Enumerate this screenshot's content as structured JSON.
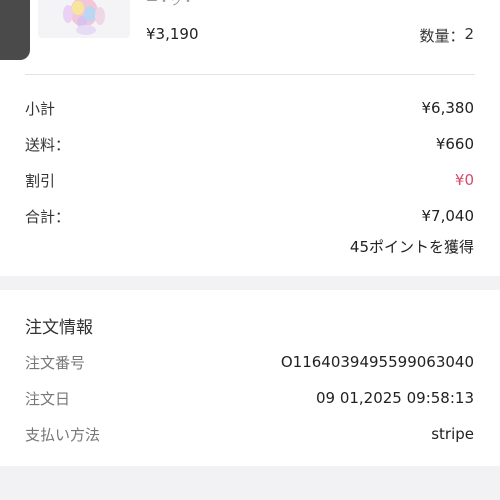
{
  "item": {
    "partial_name": "ー・ツ・",
    "price": "¥3,190",
    "quantity_label": "数量：",
    "quantity_value": "2"
  },
  "summary": {
    "rows": [
      {
        "label": "小計",
        "value": "¥6,380"
      },
      {
        "label": "送料：",
        "value": "¥660"
      },
      {
        "label": "割引",
        "value": "¥0"
      },
      {
        "label": "合計：",
        "value": "¥7,040"
      }
    ],
    "points": "45ポイントを獲得"
  },
  "order_info": {
    "title": "注文情報",
    "rows": [
      {
        "label": "注文番号",
        "value": "O1164039495599063040"
      },
      {
        "label": "注文日",
        "value": "09 01,2025 09:58:13"
      },
      {
        "label": "支払い方法",
        "value": "stripe"
      }
    ]
  },
  "colors": {
    "discount": "#d64a6e",
    "background": "#f2f2f4",
    "card": "#ffffff"
  }
}
